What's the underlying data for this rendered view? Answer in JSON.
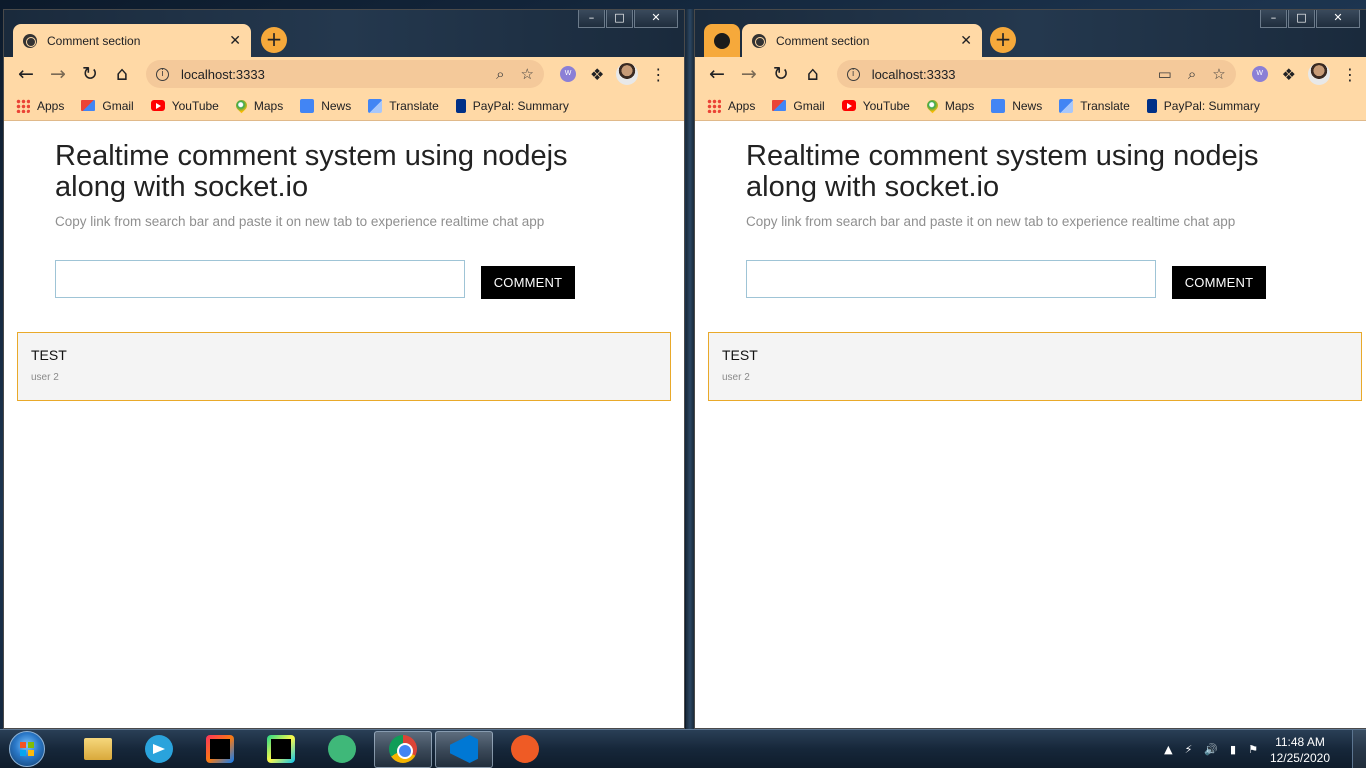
{
  "left_window": {
    "tab_title": "Comment section",
    "url": "localhost:3333"
  },
  "right_window": {
    "tab_title": "Comment section",
    "url": "localhost:3333"
  },
  "bookmarks": [
    {
      "label": "Apps",
      "icon": "apps-icon"
    },
    {
      "label": "Gmail",
      "icon": "gmail-icon"
    },
    {
      "label": "YouTube",
      "icon": "youtube-icon"
    },
    {
      "label": "Maps",
      "icon": "maps-icon"
    },
    {
      "label": "News",
      "icon": "news-icon"
    },
    {
      "label": "Translate",
      "icon": "translate-icon"
    },
    {
      "label": "PayPal: Summary",
      "icon": "paypal-icon"
    }
  ],
  "page": {
    "heading": "Realtime comment system using nodejs along with socket.io",
    "subtitle": "Copy link from search bar and paste it on new tab to experience realtime chat app",
    "comment_input_value": "",
    "comment_button": "COMMENT",
    "comments": [
      {
        "text": "TEST",
        "user": "user 2"
      }
    ]
  },
  "taskbar": {
    "apps": [
      "file-explorer",
      "telegram",
      "intellij-idea",
      "pycharm",
      "atom",
      "chrome",
      "vscode",
      "postman"
    ],
    "active_app": "chrome",
    "clock_time": "11:48 AM",
    "clock_date": "12/25/2020"
  },
  "colors": {
    "browser_frame": "#ffd9a6",
    "accent_orange": "#f6a93b",
    "comment_border": "#e9a92a",
    "button_bg": "#000000"
  }
}
